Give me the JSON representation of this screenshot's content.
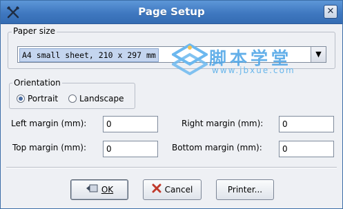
{
  "window": {
    "title": "Page Setup",
    "close_glyph": "✕",
    "app_icon": "tools-icon"
  },
  "paper": {
    "group_label": "Paper size",
    "selected": "A4 small sheet, 210 x 297 mm"
  },
  "watermark": {
    "title": "脚本学堂",
    "url": "www.jbxue.com"
  },
  "orientation": {
    "group_label": "Orientation",
    "options": [
      {
        "label": "Portrait",
        "checked": true
      },
      {
        "label": "Landscape",
        "checked": false
      }
    ]
  },
  "margins": {
    "left_label": "Left margin (mm):",
    "left_value": "0",
    "right_label": "Right margin (mm):",
    "right_value": "0",
    "top_label": "Top margin (mm):",
    "top_value": "0",
    "bottom_label": "Bottom margin (mm):",
    "bottom_value": "0"
  },
  "buttons": {
    "ok_label": "OK",
    "cancel_label": "Cancel",
    "printer_label": "Printer..."
  },
  "colors": {
    "titlebar": "#4a83c9",
    "watermark": "#4aa3e6",
    "cancel_icon": "#c0392b"
  }
}
